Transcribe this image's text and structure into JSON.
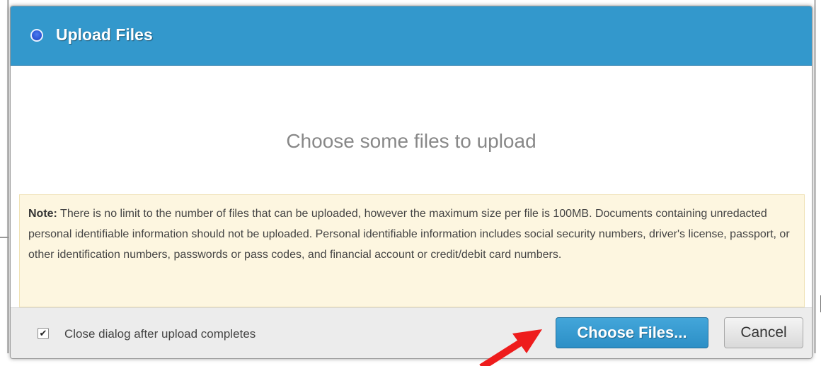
{
  "dialog": {
    "title": "Upload Files",
    "empty_message": "Choose some files to upload",
    "note": {
      "label": "Note:",
      "text": " There is no limit to the number of files that can be uploaded, however the maximum size per file is 100MB. Documents containing unredacted personal identifiable information should not be uploaded. Personal identifiable information includes social security numbers, driver's license, passport, or other identification numbers, passwords or pass codes, and financial account or credit/debit card numbers."
    },
    "footer": {
      "checkbox_label": "Close dialog after upload completes",
      "checkbox_checked": true,
      "choose_files_label": "Choose Files...",
      "cancel_label": "Cancel"
    }
  },
  "colors": {
    "titlebar": "#3398cc",
    "primary_button": "#2c8fc6",
    "note_background": "#fdf6e0",
    "annotation_arrow": "#ee1c1c"
  },
  "icons": {
    "title_icon": "blue-circle-icon",
    "annotation": "red-arrow-icon"
  }
}
